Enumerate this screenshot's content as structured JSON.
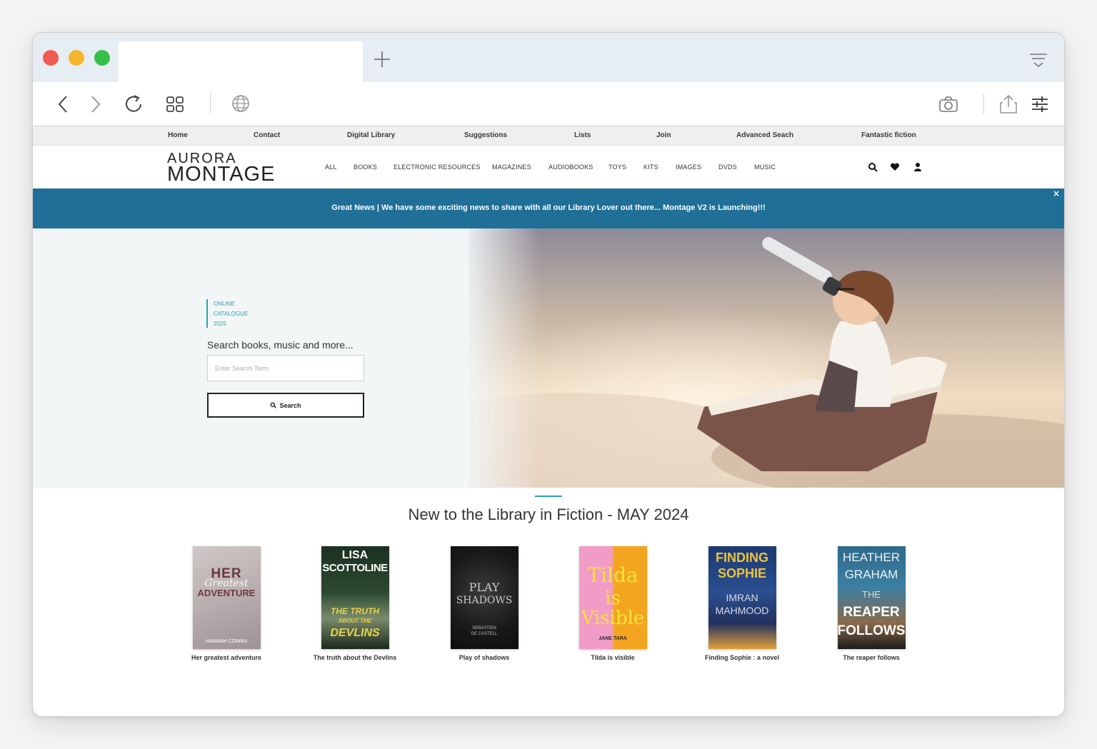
{
  "browser": {
    "tab_title": "",
    "icons": [
      "back-icon",
      "forward-icon",
      "reload-icon",
      "tab-grid-icon",
      "globe-icon",
      "camera-icon",
      "share-icon",
      "sliders-icon"
    ]
  },
  "topnav": {
    "items": [
      "Home",
      "Contact",
      "Digital Library",
      "Suggestions",
      "Lists",
      "Join",
      "Advanced Seach",
      "Fantastic fiction"
    ]
  },
  "header": {
    "logo_line1": "AURORA",
    "logo_line2": "MONTAGE",
    "categories": [
      "ALL",
      "BOOKS",
      "ELECTRONIC RESOURCES",
      "MAGAZINES",
      "AUDIOBOOKS",
      "TOYS",
      "KITS",
      "IMAGES",
      "DVDS",
      "MUSIC"
    ],
    "icons": [
      "search-icon",
      "heart-icon",
      "user-icon"
    ]
  },
  "banner": {
    "message": "Great News | We have some exciting news to share with all our Library Lover out there... Montage V2 is Launching!!!",
    "close": "×",
    "color": "#1f6f97"
  },
  "hero": {
    "tag_line1": "ONLINE",
    "tag_line2": "CATALOGUE",
    "tag_line3": "2025",
    "search_label": "Search books, music and more...",
    "search_placeholder": "Enter Search Term",
    "search_value": "",
    "search_button": "Search"
  },
  "section": {
    "title": "New to the Library in Fiction - MAY 2024",
    "books": [
      {
        "title": "Her greatest adventure",
        "cover_lines": [
          "HER",
          "Greatest",
          "ADVENTURE",
          "HANNAH COWAN"
        ]
      },
      {
        "title": "The truth about the Devlins",
        "cover_lines": [
          "LISA",
          "SCOTTOLINE",
          "THE TRUTH",
          "ABOUT THE",
          "DEVLINS"
        ]
      },
      {
        "title": "Play of shadows",
        "cover_lines": [
          "PLAY",
          "SHADOWS",
          "SEBASTIEN",
          "DE CASTELL"
        ]
      },
      {
        "title": "Tilda is visible",
        "cover_lines": [
          "Tilda",
          "is",
          "Visible",
          "JANE TARA"
        ]
      },
      {
        "title": "Finding Sophie : a novel",
        "cover_lines": [
          "FINDING",
          "SOPHIE",
          "IMRAN",
          "MAHMOOD"
        ]
      },
      {
        "title": "The reaper follows",
        "cover_lines": [
          "HEATHER",
          "GRAHAM",
          "THE",
          "REAPER",
          "FOLLOWS"
        ]
      }
    ]
  }
}
